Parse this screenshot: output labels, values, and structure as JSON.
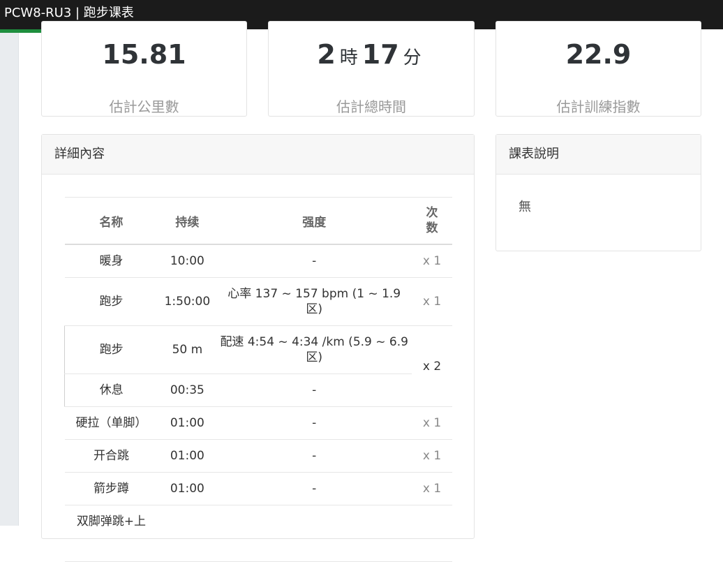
{
  "window": {
    "title": "PCW8-RU3 | 跑步课表",
    "load_progress": 0.21
  },
  "stats": {
    "distance": {
      "value": "15.81",
      "label": "估計公里數"
    },
    "duration": {
      "hours": "2",
      "hours_unit": "時",
      "minutes": "17",
      "minutes_unit": "分",
      "label": "估計總時間"
    },
    "training_index": {
      "value": "22.9",
      "label": "估計訓練指數"
    }
  },
  "detail": {
    "header": "詳細內容",
    "columns": {
      "name": "名称",
      "duration": "持续",
      "intensity": "强度",
      "reps": "次数"
    },
    "rows": [
      {
        "name": "暖身",
        "duration": "10:00",
        "intensity": "-",
        "reps": "x 1"
      },
      {
        "name": "跑步",
        "duration": "1:50:00",
        "intensity": "心率 137 ~ 157 bpm (1 ~ 1.9 区)",
        "reps": "x 1"
      },
      {
        "name": "跑步",
        "duration": "50 m",
        "intensity": "配速 4:54 ~ 4:34 /km (5.9 ~ 6.9 区)",
        "reps": "x 2"
      },
      {
        "name": "休息",
        "duration": "00:35",
        "intensity": "-"
      },
      {
        "name": "硬拉（单脚）",
        "duration": "01:00",
        "intensity": "-",
        "reps": "x 1"
      },
      {
        "name": "开合跳",
        "duration": "01:00",
        "intensity": "-",
        "reps": "x 1"
      },
      {
        "name": "箭步蹲",
        "duration": "01:00",
        "intensity": "-",
        "reps": "x 1"
      },
      {
        "name": "双脚弹跳+上"
      }
    ]
  },
  "description": {
    "header": "課表說明",
    "body": "無"
  }
}
